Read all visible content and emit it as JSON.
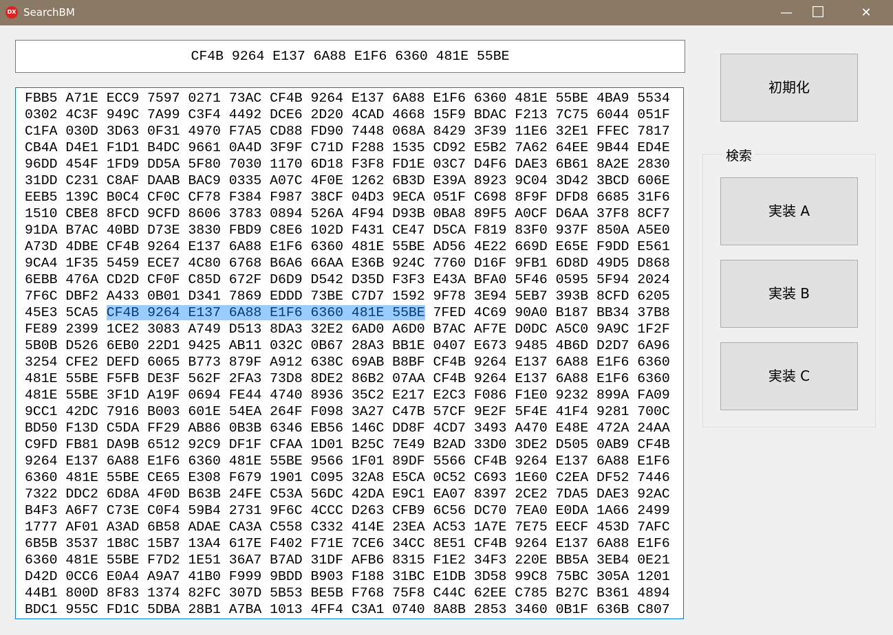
{
  "window": {
    "title": "SearchBM",
    "icon_text": "DX",
    "minimize": "—",
    "maximize": "☐",
    "close": "✕"
  },
  "query": "CF4B 9264 E137 6A88 E1F6 6360 481E 55BE",
  "buttons": {
    "reset": "初期化",
    "group_label": "検索",
    "impl_a": "実装 A",
    "impl_b": "実装 B",
    "impl_c": "実装 C"
  },
  "dump": {
    "rows": [
      "FBB5 A71E ECC9 7597 0271 73AC CF4B 9264 E137 6A88 E1F6 6360 481E 55BE 4BA9 5534",
      "0302 4C3F 949C 7A99 C3F4 4492 DCE6 2D20 4CAD 4668 15F9 BDAC F213 7C75 6044 051F",
      "C1FA 030D 3D63 0F31 4970 F7A5 CD88 FD90 7448 068A 8429 3F39 11E6 32E1 FFEC 7817",
      "CB4A D4E1 F1D1 B4DC 9661 0A4D 3F9F C71D F288 1535 CD92 E5B2 7A62 64EE 9B44 ED4E",
      "96DD 454F 1FD9 DD5A 5F80 7030 1170 6D18 F3F8 FD1E 03C7 D4F6 DAE3 6B61 8A2E 2830",
      "31DD C231 C8AF DAAB BAC9 0335 A07C 4F0E 1262 6B3D E39A 8923 9C04 3D42 3BCD 606E",
      "EEB5 139C B0C4 CF0C CF78 F384 F987 38CF 04D3 9ECA 051F C698 8F9F DFD8 6685 31F6",
      "1510 CBE8 8FCD 9CFD 8606 3783 0894 526A 4F94 D93B 0BA8 89F5 A0CF D6AA 37F8 8CF7",
      "91DA B7AC 40BD D73E 3830 FBD9 C8E6 102D F431 CE47 D5CA F819 83F0 937F 850A A5E0",
      "A73D 4DBE CF4B 9264 E137 6A88 E1F6 6360 481E 55BE AD56 4E22 669D E65E F9DD E561",
      "9CA4 1F35 5459 ECE7 4C80 6768 B6A6 66AA E36B 924C 7760 D16F 9FB1 6D8D 49D5 D868",
      "6EBB 476A CD2D CF0F C85D 672F D6D9 D542 D35D F3F3 E43A BFA0 5F46 0595 5F94 2024",
      "7F6C DBF2 A433 0B01 D341 7869 EDDD 73BE C7D7 1592 9F78 3E94 5EB7 393B 8CFD 6205",
      "",
      "FE89 2399 1CE2 3083 A749 D513 8DA3 32E2 6AD0 A6D0 B7AC AF7E D0DC A5C0 9A9C 1F2F",
      "5B0B D526 6EB0 22D1 9425 AB11 032C 0B67 28A3 BB1E 0407 E673 9485 4B6D D2D7 6A96",
      "3254 CFE2 DEFD 6065 B773 879F A912 638C 69AB B8BF CF4B 9264 E137 6A88 E1F6 6360",
      "481E 55BE F5FB DE3F 562F 2FA3 73D8 8DE2 86B2 07AA CF4B 9264 E137 6A88 E1F6 6360",
      "481E 55BE 3F1D A19F 0694 FE44 4740 8936 35C2 E217 E2C3 F086 F1E0 9232 899A FA09",
      "9CC1 42DC 7916 B003 601E 54EA 264F F098 3A27 C47B 57CF 9E2F 5F4E 41F4 9281 700C",
      "BD50 F13D C5DA FF29 AB86 0B3B 6346 EB56 146C DD8F 4CD7 3493 A470 E48E 472A 24AA",
      "C9FD FB81 DA9B 6512 92C9 DF1F CFAA 1D01 B25C 7E49 B2AD 33D0 3DE2 D505 0AB9 CF4B",
      "9264 E137 6A88 E1F6 6360 481E 55BE 9566 1F01 89DF 5566 CF4B 9264 E137 6A88 E1F6",
      "6360 481E 55BE CE65 E308 F679 1901 C095 32A8 E5CA 0C52 C693 1E60 C2EA DF52 7446",
      "7322 DDC2 6D8A 4F0D B63B 24FE C53A 56DC 42DA E9C1 EA07 8397 2CE2 7DA5 DAE3 92AC",
      "B4F3 A6F7 C73E C0F4 59B4 2731 9F6C 4CCC D263 CFB9 6C56 DC70 7EA0 E0DA 1A66 2499",
      "1777 AF01 A3AD 6B58 ADAE CA3A C558 C332 414E 23EA AC53 1A7E 7E75 EECF 453D 7AFC",
      "6B5B 3537 1B8C 15B7 13A4 617E F402 F71E 7CE6 34CC 8E51 CF4B 9264 E137 6A88 E1F6",
      "6360 481E 55BE F7D2 1E51 36A7 B7AD 31DF AFB6 8315 F1E2 34F3 220E BB5A 3EB4 0E21",
      "D42D 0CC6 E0A4 A9A7 41B0 F999 9BDD B903 F188 31BC E1DB 3D58 99C8 75BC 305A 1201",
      "44B1 800D 8F83 1374 82FC 307D 5B53 BE5B F768 75F8 C44C 62EE C785 B27C B361 4894",
      "BDC1 955C FD1C 5DBA 28B1 A7BA 1013 4FF4 C3A1 0740 8A8B 2853 3460 0B1F 636B C807"
    ],
    "match_row": {
      "before": "45E3 5CA5 ",
      "selected": "CF4B 9264 E137 6A88 E1F6 6360 481E 55BE",
      "after": " 7FED 4C69 90A0 B187 BB34 37B8"
    }
  }
}
